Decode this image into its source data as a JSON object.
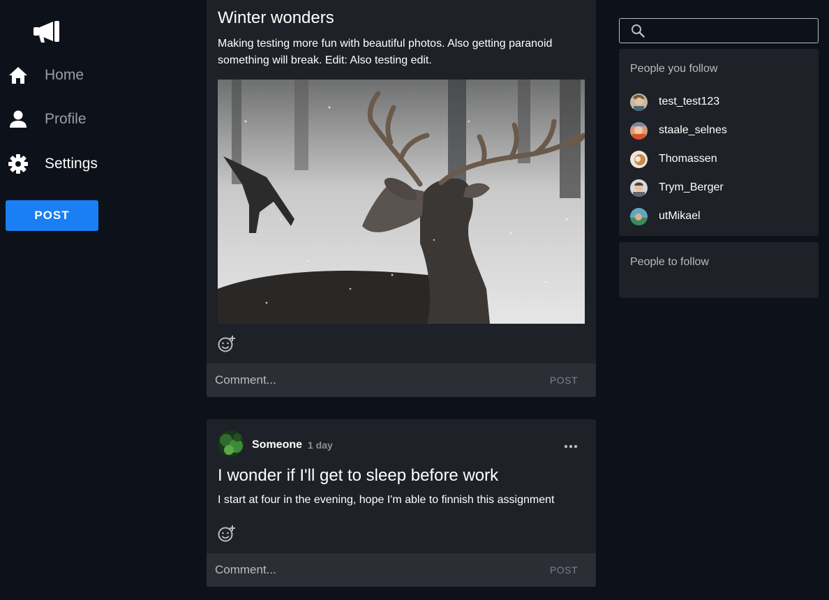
{
  "sidebar": {
    "logo_icon": "megaphone-icon",
    "nav": [
      {
        "label": "Home",
        "icon": "home-icon"
      },
      {
        "label": "Profile",
        "icon": "user-icon"
      },
      {
        "label": "Settings",
        "icon": "gear-icon"
      }
    ],
    "post_button": "POST"
  },
  "feed": {
    "posts": [
      {
        "title": "Winter wonders",
        "body": "Making testing more fun with beautiful photos. Also getting paranoid something will break. Edit: Also testing edit.",
        "image": "deer-in-snow-photo",
        "comment_placeholder": "Comment...",
        "comment_post": "POST"
      },
      {
        "author": "Someone",
        "time": "1 day",
        "title": "I wonder if I'll get to sleep before work",
        "body": "I start at four in the evening, hope I'm able to finnish this assignment",
        "comment_placeholder": "Comment...",
        "comment_post": "POST"
      }
    ]
  },
  "right_panel": {
    "search_placeholder": "",
    "following_title": "People you follow",
    "following": [
      {
        "name": "test_test123"
      },
      {
        "name": "staale_selnes"
      },
      {
        "name": "Thomassen"
      },
      {
        "name": "Trym_Berger"
      },
      {
        "name": "utMikael"
      }
    ],
    "to_follow_title": "People to follow"
  },
  "colors": {
    "background": "#0d111a",
    "card": "#1e2128",
    "comment_bar": "#2b2e35",
    "accent": "#1a7ff5"
  }
}
